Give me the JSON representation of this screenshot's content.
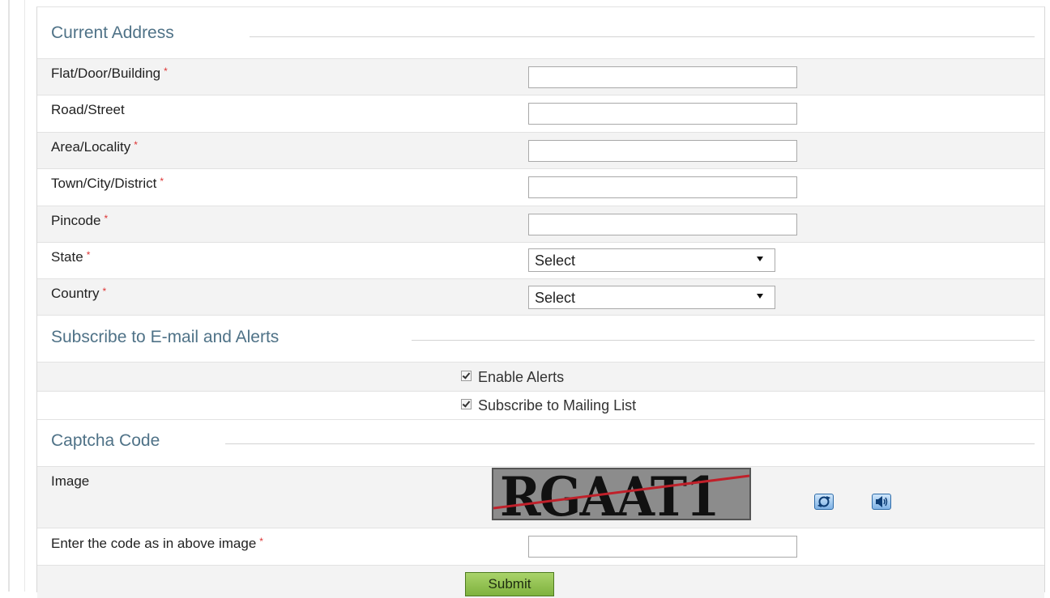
{
  "sections": {
    "address": {
      "title": "Current Address"
    },
    "subscribe": {
      "title": "Subscribe to E-mail and Alerts"
    },
    "captcha": {
      "title": "Captcha Code"
    }
  },
  "fields": {
    "flat": {
      "label": "Flat/Door/Building",
      "required": "*",
      "value": ""
    },
    "road": {
      "label": "Road/Street",
      "value": ""
    },
    "area": {
      "label": "Area/Locality",
      "required": "*",
      "value": ""
    },
    "town": {
      "label": "Town/City/District",
      "required": "*",
      "value": ""
    },
    "pincode": {
      "label": "Pincode",
      "required": "*",
      "value": ""
    },
    "state": {
      "label": "State",
      "required": "*",
      "selected": "Select"
    },
    "country": {
      "label": "Country",
      "required": "*",
      "selected": "Select"
    }
  },
  "options": {
    "alerts": {
      "label": "Enable Alerts",
      "checked": true
    },
    "mailing": {
      "label": "Subscribe to Mailing List",
      "checked": true
    }
  },
  "captcha": {
    "image_label": "Image",
    "image_text": "RGAAT1",
    "refresh_icon": "refresh-icon",
    "audio_icon": "speaker-icon",
    "code_label": "Enter the code as in above image",
    "code_required": "*",
    "code_value": ""
  },
  "actions": {
    "submit": "Submit"
  },
  "colors": {
    "section_title": "#4f7287",
    "row_alt": "#f3f3f3",
    "required": "#dd3333",
    "submit": "#8cc04e"
  }
}
